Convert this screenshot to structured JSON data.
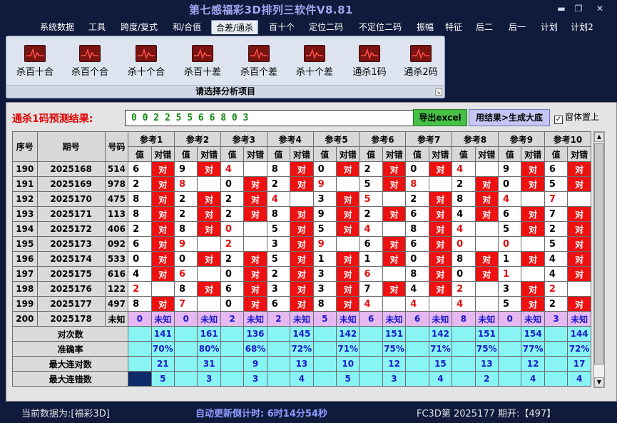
{
  "app": {
    "title": "第七感福彩3D排列三软件V8.81"
  },
  "menu": {
    "items": [
      "系统数据",
      "工具",
      "跨度/复式",
      "和/合值",
      "合差/通杀",
      "百十个",
      "定位二码",
      "不定位二码",
      "振幅",
      "特征",
      "后二",
      "后一",
      "计划",
      "计划2"
    ],
    "active": "合差/通杀"
  },
  "ribbon": {
    "buttons": [
      "杀百十合",
      "杀百个合",
      "杀十个合",
      "杀百十差",
      "杀百个差",
      "杀十个差",
      "通杀1码",
      "通杀2码"
    ],
    "icon": "chart-pulse-icon",
    "caption": "请选择分析项目"
  },
  "prediction": {
    "label": "通杀1码预测结果:",
    "value": "0 0 2 2 5 5 6 6 8 0 3",
    "export_label": "导出excel",
    "generate_label": "用结果>生成大底",
    "topmost_label": "窗体置上",
    "topmost_checked": true
  },
  "table": {
    "headers": {
      "index": "序号",
      "period": "期号",
      "number": "号码",
      "refs": [
        "参考1",
        "参考2",
        "参考3",
        "参考4",
        "参考5",
        "参考6",
        "参考7",
        "参考8",
        "参考9",
        "参考10"
      ],
      "value": "值",
      "result": "对错"
    },
    "hit_text": "对",
    "rows": [
      {
        "idx": "190",
        "period": "2025168",
        "num": "514",
        "v": [
          "6",
          "9",
          "4",
          "8",
          "0",
          "2",
          "0",
          "4",
          "9",
          "6"
        ],
        "hit": [
          1,
          1,
          0,
          1,
          1,
          1,
          1,
          0,
          1,
          1
        ],
        "red": [
          0,
          0,
          1,
          0,
          0,
          0,
          0,
          1,
          0,
          0
        ]
      },
      {
        "idx": "191",
        "period": "2025169",
        "num": "978",
        "v": [
          "2",
          "8",
          "0",
          "2",
          "9",
          "5",
          "8",
          "2",
          "0",
          "5"
        ],
        "hit": [
          1,
          0,
          1,
          1,
          0,
          1,
          0,
          1,
          1,
          1
        ],
        "red": [
          0,
          1,
          0,
          0,
          1,
          0,
          1,
          0,
          0,
          0
        ]
      },
      {
        "idx": "192",
        "period": "2025170",
        "num": "475",
        "v": [
          "8",
          "2",
          "2",
          "4",
          "3",
          "5",
          "2",
          "8",
          "4",
          "7"
        ],
        "hit": [
          1,
          1,
          1,
          0,
          1,
          0,
          1,
          1,
          0,
          0
        ],
        "red": [
          0,
          0,
          0,
          1,
          0,
          1,
          0,
          0,
          1,
          1
        ]
      },
      {
        "idx": "193",
        "period": "2025171",
        "num": "113",
        "v": [
          "8",
          "2",
          "2",
          "8",
          "9",
          "2",
          "6",
          "4",
          "6",
          "7"
        ],
        "hit": [
          1,
          1,
          1,
          1,
          1,
          1,
          1,
          1,
          1,
          1
        ],
        "red": [
          0,
          0,
          0,
          0,
          0,
          0,
          0,
          0,
          0,
          0
        ]
      },
      {
        "idx": "194",
        "period": "2025172",
        "num": "406",
        "v": [
          "2",
          "8",
          "0",
          "5",
          "5",
          "4",
          "8",
          "4",
          "5",
          "2"
        ],
        "hit": [
          1,
          1,
          0,
          1,
          1,
          0,
          1,
          0,
          1,
          1
        ],
        "red": [
          0,
          0,
          1,
          0,
          0,
          1,
          0,
          1,
          0,
          0
        ]
      },
      {
        "idx": "195",
        "period": "2025173",
        "num": "092",
        "v": [
          "6",
          "9",
          "2",
          "3",
          "9",
          "6",
          "6",
          "0",
          "0",
          "5"
        ],
        "hit": [
          1,
          0,
          0,
          1,
          0,
          1,
          1,
          0,
          0,
          1
        ],
        "red": [
          0,
          1,
          1,
          0,
          1,
          0,
          0,
          1,
          1,
          0
        ]
      },
      {
        "idx": "196",
        "period": "2025174",
        "num": "533",
        "v": [
          "0",
          "0",
          "2",
          "5",
          "1",
          "1",
          "0",
          "8",
          "1",
          "4"
        ],
        "hit": [
          1,
          1,
          1,
          1,
          1,
          1,
          1,
          1,
          1,
          1
        ],
        "red": [
          0,
          0,
          0,
          0,
          0,
          0,
          0,
          0,
          0,
          0
        ]
      },
      {
        "idx": "197",
        "period": "2025175",
        "num": "616",
        "v": [
          "4",
          "6",
          "0",
          "2",
          "3",
          "6",
          "8",
          "0",
          "1",
          "4"
        ],
        "hit": [
          1,
          0,
          1,
          1,
          1,
          0,
          1,
          1,
          0,
          1
        ],
        "red": [
          0,
          1,
          0,
          0,
          0,
          1,
          0,
          0,
          1,
          0
        ]
      },
      {
        "idx": "198",
        "period": "2025176",
        "num": "122",
        "v": [
          "2",
          "8",
          "6",
          "3",
          "3",
          "7",
          "4",
          "2",
          "3",
          "2"
        ],
        "hit": [
          0,
          1,
          1,
          1,
          1,
          1,
          1,
          0,
          1,
          0
        ],
        "red": [
          1,
          0,
          0,
          0,
          0,
          0,
          0,
          1,
          0,
          1
        ]
      },
      {
        "idx": "199",
        "period": "2025177",
        "num": "497",
        "v": [
          "8",
          "7",
          "0",
          "6",
          "8",
          "4",
          "4",
          "4",
          "5",
          "2"
        ],
        "hit": [
          1,
          0,
          1,
          1,
          1,
          0,
          0,
          0,
          1,
          1
        ],
        "red": [
          0,
          1,
          0,
          0,
          0,
          1,
          1,
          1,
          0,
          0
        ]
      }
    ],
    "unknown_row": {
      "idx": "200",
      "period": "2025178",
      "num": "未知",
      "v": [
        "0",
        "0",
        "2",
        "2",
        "5",
        "6",
        "6",
        "8",
        "0",
        "3"
      ],
      "text": "未知"
    },
    "stats": [
      {
        "label": "对次数",
        "values": [
          "141",
          "161",
          "136",
          "145",
          "142",
          "151",
          "142",
          "151",
          "154",
          "144"
        ]
      },
      {
        "label": "准确率",
        "values": [
          "70%",
          "80%",
          "68%",
          "72%",
          "71%",
          "75%",
          "71%",
          "75%",
          "77%",
          "72%"
        ]
      },
      {
        "label": "最大连对数",
        "values": [
          "21",
          "31",
          "9",
          "13",
          "10",
          "12",
          "15",
          "13",
          "12",
          "17"
        ]
      },
      {
        "label": "最大连错数",
        "values": [
          "5",
          "3",
          "3",
          "4",
          "5",
          "3",
          "4",
          "2",
          "4",
          "4"
        ]
      }
    ]
  },
  "status": {
    "current": "当前数据为:[福彩3D]",
    "countdown": "自动更新倒计时: 6时14分54秒",
    "draw": "FC3D第 2025177 期开:【497】"
  },
  "colors": {
    "hit": "#ee1111",
    "stat_bg": "#88f4f4",
    "unknown_bg": "#e6b8f2",
    "export_btn": "#46c046",
    "generate_btn": "#c6c6f4"
  }
}
